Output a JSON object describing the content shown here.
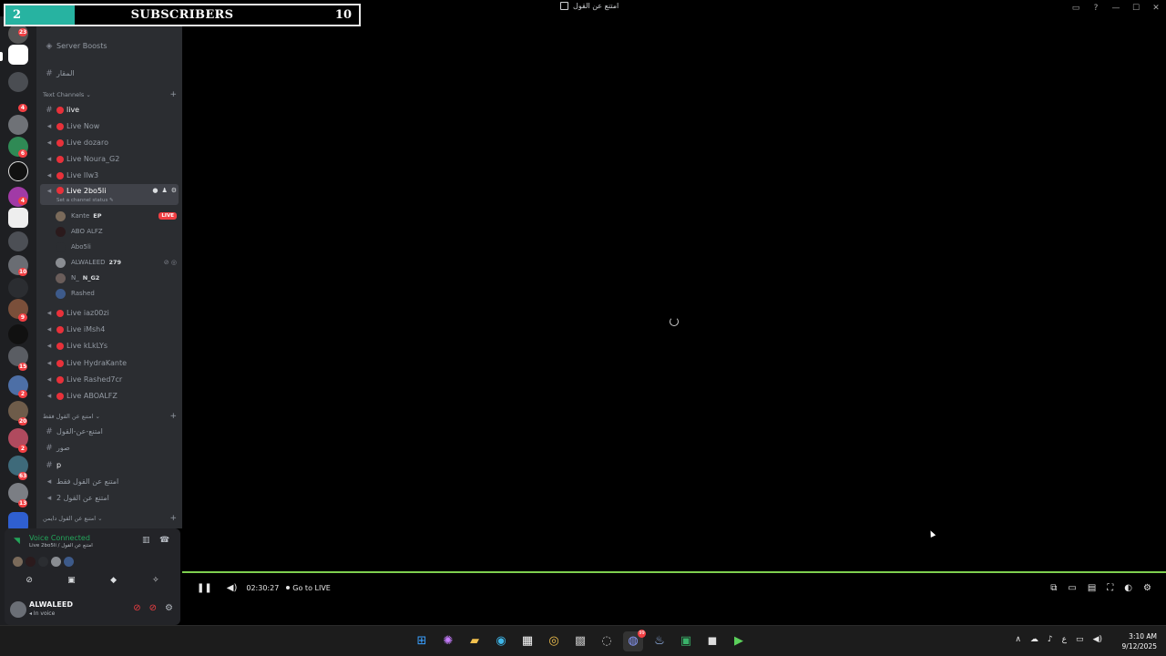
{
  "window": {
    "title": "امتنع عن القول"
  },
  "overlay": {
    "goal_current": "2",
    "label": "SUBSCRIBERS",
    "goal_target": "10"
  },
  "rail_badges": [
    "23",
    "4",
    "6",
    "4",
    "10",
    "9",
    "15",
    "2",
    "20",
    "2",
    "63",
    "13"
  ],
  "sidebar": {
    "server_boosts": "Server Boosts",
    "top_channel": "المقار",
    "category_text": "Text Channels",
    "channels": [
      {
        "name": "live",
        "type": "text"
      },
      {
        "name": "Live Now",
        "type": "voice"
      },
      {
        "name": "Live dozaro",
        "type": "voice"
      },
      {
        "name": "Live Noura_G2",
        "type": "voice"
      },
      {
        "name": "Live Ilw3",
        "type": "voice"
      },
      {
        "name": "Live 2bo5li",
        "type": "voice",
        "active": true
      }
    ],
    "channel_status": "Set a channel status",
    "voice_users": [
      {
        "name": "Kante",
        "tag": "EP",
        "live": "LIVE"
      },
      {
        "name": "ABO ALFZ"
      },
      {
        "name": "Abo5li"
      },
      {
        "name": "ALWALEED",
        "tag": "279"
      },
      {
        "name": "N_",
        "tag": "N_G2"
      },
      {
        "name": "Rashed"
      }
    ],
    "more_channels": [
      "Live iaz00zi",
      "Live iMsh4",
      "Live kLkLYs",
      "Live HydraKante",
      "Live Rashed7cr",
      "Live ABOALFZ"
    ],
    "category_2": "امتنع عن القول فقط",
    "cat2_channels": [
      "امتنع-عن-القول",
      "صور",
      "p",
      "امتنع عن القول فقط",
      "امتنع عن القول 2"
    ],
    "category_3": "امتنع عن القول دايمن"
  },
  "voice_panel": {
    "title": "Voice Connected",
    "subtitle": "Live 2bo5li / امتنع عن القول"
  },
  "user_panel": {
    "name": "ALWALEED",
    "status": "In voice"
  },
  "player": {
    "time": "02:30:27",
    "go_live": "Go to LIVE"
  },
  "taskbar": {
    "discord_badge": "99",
    "lang": "ع",
    "time": "3:10 AM",
    "date": "9/12/2025"
  }
}
